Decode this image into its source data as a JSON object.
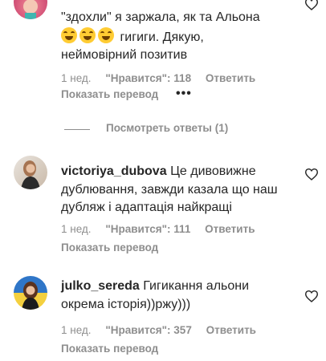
{
  "comments": [
    {
      "text_line1": "\"здохли\" я заржала, як та Альона",
      "text_line2_suffix": "гигиги. Дякую,",
      "text_line3": "неймовірний позитив",
      "emojis": [
        "tears-of-joy",
        "tears-of-joy",
        "tears-of-joy"
      ],
      "time": "1 нед.",
      "likes": "\"Нравится\": 118",
      "reply_label": "Ответить",
      "translate_label": "Показать перевод",
      "more_label": "•••",
      "view_replies": "Посмотреть ответы (1)"
    },
    {
      "username": "victoriya_dubova",
      "text": "Це дивовижне дублювання, завжди казала що наш дубляж і адаптація найкращі",
      "time": "1 нед.",
      "likes": "\"Нравится\": 111",
      "reply_label": "Ответить",
      "translate_label": "Показать перевод"
    },
    {
      "username": "julko_sereda",
      "text": "Гигикання альони окрема історія))ржу)))",
      "time": "1 нед.",
      "likes": "\"Нравится\": 357",
      "reply_label": "Ответить",
      "translate_label": "Показать перевод"
    }
  ],
  "colors": {
    "text": "#262626",
    "secondary": "#8e8e8e"
  },
  "icons": {
    "like": "heart-outline-icon"
  }
}
